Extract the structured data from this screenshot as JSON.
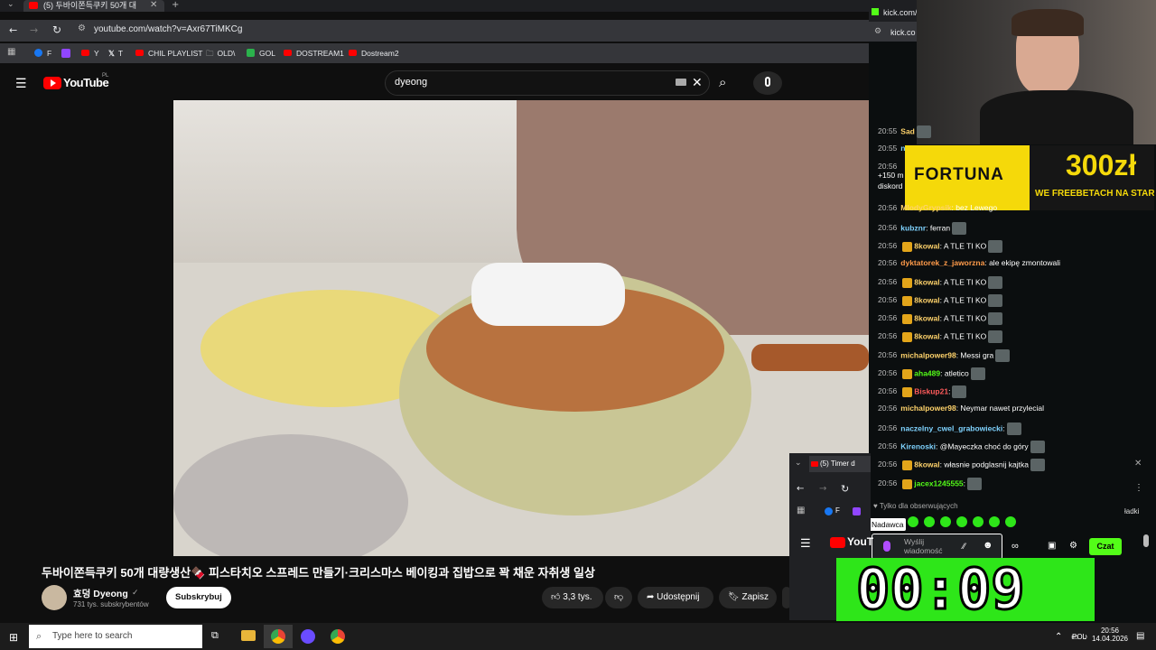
{
  "browser": {
    "tab_title": "(5) 두바이쫀득쿠키 50개 대",
    "url": "youtube.com/watch?v=Axr67TiMKCg",
    "bookmarks": [
      "F",
      "Y",
      "T",
      "CHIL PLAYLIST",
      "OLD\\",
      "GOL",
      "DOSTREAM1",
      "Dostream2"
    ]
  },
  "youtube": {
    "logo_text": "YouTube",
    "logo_region": "PL",
    "search_value": "dyeong",
    "video_title": "두바이쫀득쿠키 50개 대량생산🍫 피스타치오 스프레드 만들기·크리스마스 베이킹과 집밥으로 꽉 채운 자취생 일상",
    "channel_name": "효덩 Dyeong",
    "subscribers": "731 tys. subskrybentów",
    "subscribe_label": "Subskrybuj",
    "likes": "3,3 tys.",
    "share_label": "Udostępnij",
    "save_label": "Zapisz"
  },
  "kick": {
    "tab1": "kick.com/",
    "tab2": "kick.co",
    "follower_only": "Tylko dla obserwujących",
    "send_placeholder": "Wyślij wiadomość",
    "send_tooltip": "Nadawca",
    "chat_button": "Czat",
    "messages": [
      {
        "time": "20:55",
        "user": "Sad",
        "color": "#ffd36b",
        "text": "",
        "badge": false,
        "emote": true
      },
      {
        "time": "20:55",
        "user": "n",
        "color": "#7fd3ff",
        "text": "",
        "badge": false,
        "emote": false
      },
      {
        "time": "20:56",
        "user": "",
        "color": "#fff",
        "text": "",
        "badge": false,
        "emote": false
      },
      {
        "time": "",
        "user": "",
        "color": "#fff",
        "text": "+150 m",
        "badge": false,
        "emote": false
      },
      {
        "time": "",
        "user": "",
        "color": "#fff",
        "text": "diskord",
        "badge": false,
        "emote": false
      },
      {
        "time": "20:56",
        "user": "MlodyGrypsik",
        "color": "#ffd36b",
        "text": ": bez Lewego",
        "badge": false,
        "emote": false
      },
      {
        "time": "20:56",
        "user": "kubznr",
        "color": "#7fd3ff",
        "text": ": ferran",
        "badge": false,
        "emote": true
      },
      {
        "time": "20:56",
        "user": "8kowal",
        "color": "#ffd36b",
        "text": ": A TLE TI KO",
        "badge": true,
        "emote": true
      },
      {
        "time": "20:56",
        "user": "dyktatorek_z_jaworzna",
        "color": "#ff9b4a",
        "text": ": ale ekipę zmontowali",
        "badge": false,
        "emote": false
      },
      {
        "time": "20:56",
        "user": "8kowal",
        "color": "#ffd36b",
        "text": ": A TLE TI KO",
        "badge": true,
        "emote": true
      },
      {
        "time": "20:56",
        "user": "8kowal",
        "color": "#ffd36b",
        "text": ": A TLE TI KO",
        "badge": true,
        "emote": true
      },
      {
        "time": "20:56",
        "user": "8kowal",
        "color": "#ffd36b",
        "text": ": A TLE TI KO",
        "badge": true,
        "emote": true
      },
      {
        "time": "20:56",
        "user": "8kowal",
        "color": "#ffd36b",
        "text": ": A TLE TI KO",
        "badge": true,
        "emote": true
      },
      {
        "time": "20:56",
        "user": "michalpower98",
        "color": "#ffd36b",
        "text": ": Messi gra",
        "badge": false,
        "emote": true
      },
      {
        "time": "20:56",
        "user": "aha489",
        "color": "#53fc18",
        "text": ": atletico",
        "badge": true,
        "emote": true
      },
      {
        "time": "20:56",
        "user": "Biskup21",
        "color": "#ff5b5b",
        "text": ":",
        "badge": true,
        "emote": true
      },
      {
        "time": "20:56",
        "user": "michalpower98",
        "color": "#ffd36b",
        "text": ": Neymar nawet przylecial",
        "badge": false,
        "emote": false
      },
      {
        "time": "20:56",
        "user": "naczelny_cwel_grabowiecki",
        "color": "#7fd3ff",
        "text": ":",
        "badge": false,
        "emote": true
      },
      {
        "time": "20:56",
        "user": "Kirenoski",
        "color": "#7fd3ff",
        "text": ": @Mayeczka choć do góry",
        "badge": false,
        "emote": true
      },
      {
        "time": "20:56",
        "user": "8kowal",
        "color": "#ffd36b",
        "text": ": własnie podglasnij kajtka",
        "badge": true,
        "emote": true
      },
      {
        "time": "20:56",
        "user": "jacex1245555",
        "color": "#53fc18",
        "text": ":",
        "badge": true,
        "emote": true
      }
    ]
  },
  "fortuna": {
    "brand": "FORTUNA",
    "amount": "300zł",
    "tagline": "WE FREEBETACH NA START"
  },
  "popup": {
    "tab": "(5) Timer d",
    "yt_logo": "YouT",
    "bookmark_tail": "ładki"
  },
  "timer_display": "00:09",
  "taskbar": {
    "search_placeholder": "Type here to search",
    "lang": "POL",
    "time": "20:56",
    "date": "14.04.2026"
  }
}
